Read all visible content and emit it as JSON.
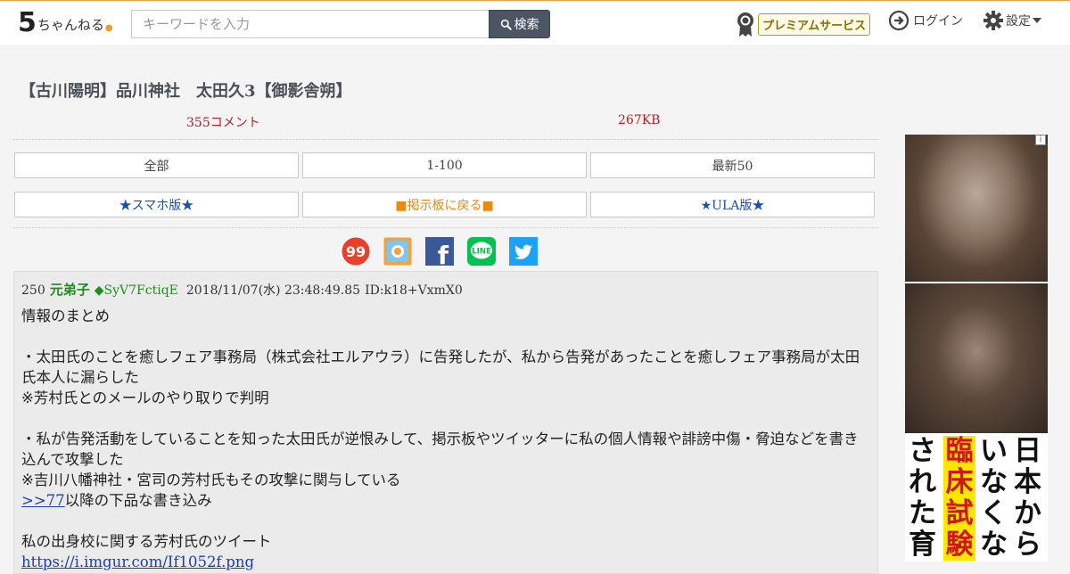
{
  "header": {
    "logo_num": "5",
    "logo_text": "ちゃんねる",
    "search_placeholder": "キーワードを入力",
    "search_button": "検索",
    "premium_label": "プレミアムサービス",
    "login_label": "ログイン",
    "settings_label": "設定"
  },
  "thread": {
    "title": "【古川陽明】品川神社　太田久3【御影舎朔】",
    "comments": "355コメント",
    "size": "267KB"
  },
  "nav": {
    "row1": [
      "全部",
      "1-100",
      "最新50"
    ],
    "row2": [
      "★スマホ版★",
      "■掲示板に戻る■",
      "★ULA版★"
    ]
  },
  "share": {
    "icons": [
      "5ch-99-icon",
      "bookmark-icon",
      "facebook-icon",
      "line-icon",
      "twitter-icon"
    ],
    "line_text": "LINE",
    "facebook_text": "f",
    "ninetynine_text": "99"
  },
  "post": {
    "number": "250",
    "name": "元弟子",
    "trip": "◆SyV7FctiqE",
    "date": "2018/11/07(水) 23:48:49.85",
    "id": "ID:k18+VxmX0",
    "lines": [
      "情報のまとめ",
      "",
      "・太田氏のことを癒しフェア事務局（株式会社エルアウラ）に告発したが、私から告発があったことを癒しフェア事務局が太田氏本人に漏らした",
      "※芳村氏とのメールのやり取りで判明",
      "",
      "・私が告発活動をしていることを知った太田氏が逆恨みして、掲示板やツイッターに私の個人情報や誹謗中傷・脅迫などを書き込んで攻撃した",
      "※吉川八幡神社・宮司の芳村氏もその攻撃に関与している"
    ],
    "anchor": ">>77",
    "anchor_suffix": "以降の下品な書き込み",
    "line_after": "私の出身校に関する芳村氏のツイート",
    "link": "https://i.imgur.com/If1052f.png"
  },
  "ad": {
    "info": "i",
    "col1": [
      "日",
      "本",
      "か",
      "ら"
    ],
    "col2": [
      "い",
      "な",
      "く",
      "な"
    ],
    "col3": [
      "臨",
      "床",
      "試",
      "験"
    ],
    "col4": [
      "さ",
      "れ",
      "た",
      "育"
    ]
  },
  "colors": {
    "accent_orange": "#e88a13",
    "comment_red": "#b22222",
    "name_green": "#1f8c1f",
    "link_blue": "#1c3fb0"
  }
}
